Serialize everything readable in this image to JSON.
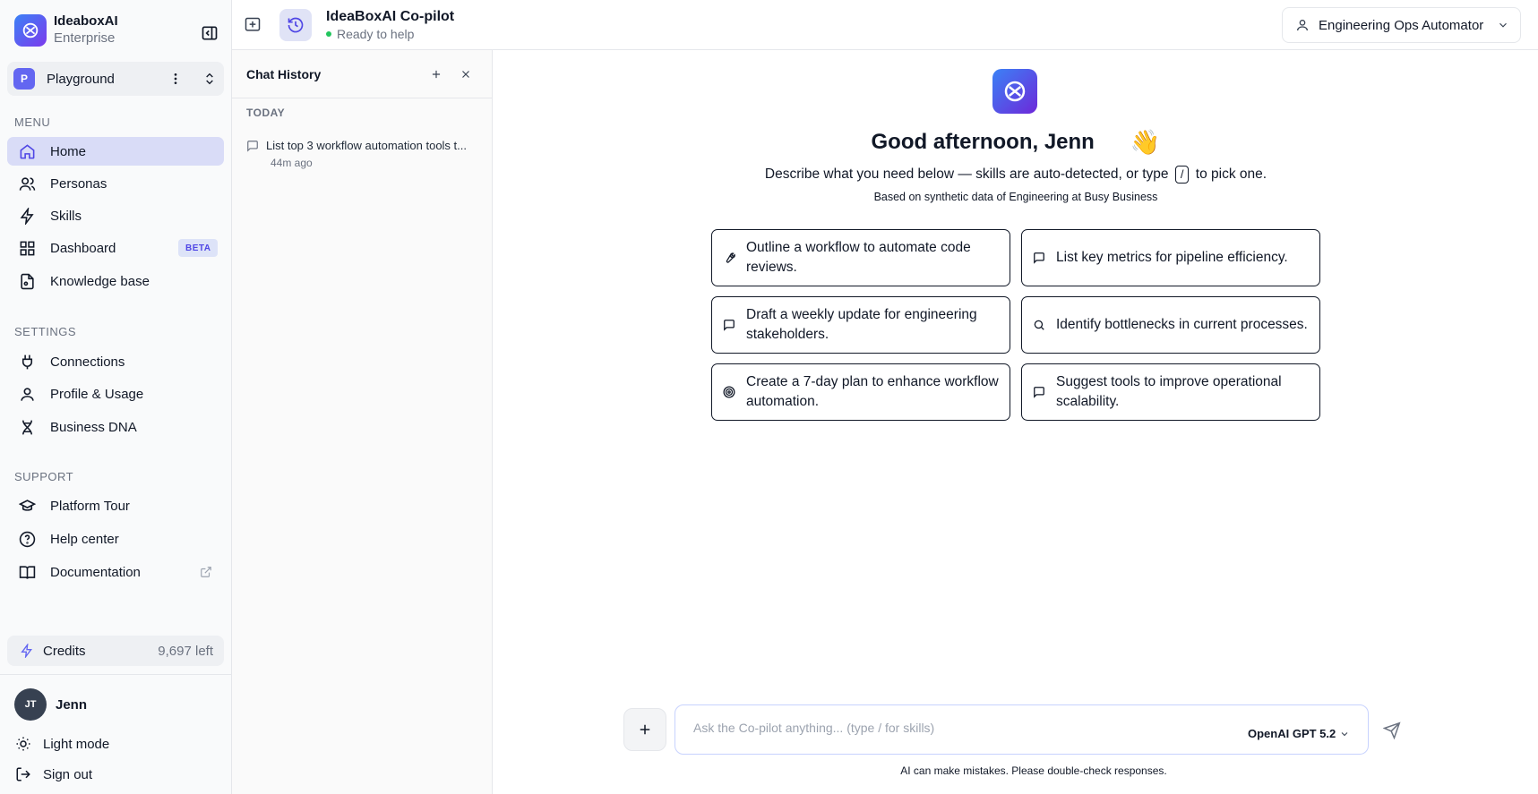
{
  "brand": {
    "name": "IdeaboxAI",
    "plan": "Enterprise"
  },
  "workspace": {
    "initial": "P",
    "name": "Playground"
  },
  "sidebar": {
    "menu_label": "MENU",
    "menu": [
      {
        "label": "Home",
        "icon": "home-icon",
        "active": true
      },
      {
        "label": "Personas",
        "icon": "users-icon"
      },
      {
        "label": "Skills",
        "icon": "zap-icon"
      },
      {
        "label": "Dashboard",
        "icon": "grid-icon",
        "badge": "BETA"
      },
      {
        "label": "Knowledge base",
        "icon": "file-icon"
      }
    ],
    "settings_label": "SETTINGS",
    "settings": [
      {
        "label": "Connections",
        "icon": "plug-icon"
      },
      {
        "label": "Profile & Usage",
        "icon": "user-icon"
      },
      {
        "label": "Business DNA",
        "icon": "dna-icon"
      }
    ],
    "support_label": "SUPPORT",
    "support": [
      {
        "label": "Platform Tour",
        "icon": "graduation-cap-icon"
      },
      {
        "label": "Help center",
        "icon": "help-circle-icon"
      },
      {
        "label": "Documentation",
        "icon": "book-icon"
      }
    ],
    "credits": {
      "label": "Credits",
      "left": "9,697 left"
    },
    "user": {
      "initials": "JT",
      "name": "Jenn"
    },
    "light_mode": "Light mode",
    "sign_out": "Sign out"
  },
  "topbar": {
    "title": "IdeaBoxAI Co-pilot",
    "status": "Ready to help",
    "persona": "Engineering Ops Automator"
  },
  "history": {
    "title": "Chat History",
    "group": "TODAY",
    "items": [
      {
        "title": "List top 3 workflow automation tools t...",
        "time": "44m ago"
      }
    ]
  },
  "main": {
    "greeting": "Good afternoon, Jenn",
    "wave": "👋",
    "sub_before": "Describe what you need below — skills are auto-detected, or type",
    "slash": "/",
    "sub_after": "to pick one.",
    "data_note": "Based on synthetic data of Engineering at Busy Business",
    "suggestions": [
      {
        "text": "Outline a workflow to automate code reviews.",
        "icon": "wrench-icon"
      },
      {
        "text": "List key metrics for pipeline efficiency.",
        "icon": "message-icon"
      },
      {
        "text": "Draft a weekly update for engineering stakeholders.",
        "icon": "message-icon"
      },
      {
        "text": "Identify bottlenecks in current processes.",
        "icon": "search-icon"
      },
      {
        "text": "Create a 7-day plan to enhance workflow automation.",
        "icon": "target-icon"
      },
      {
        "text": "Suggest tools to improve operational scalability.",
        "icon": "message-icon"
      }
    ],
    "composer": {
      "placeholder": "Ask the Co-pilot anything... (type / for skills)",
      "model": "OpenAI GPT 5.2"
    },
    "disclaimer": "AI can make mistakes. Please double-check responses."
  },
  "colors": {
    "accent": "#6366f1",
    "active_nav": "#d9dcf7",
    "status_green": "#22c55e"
  }
}
